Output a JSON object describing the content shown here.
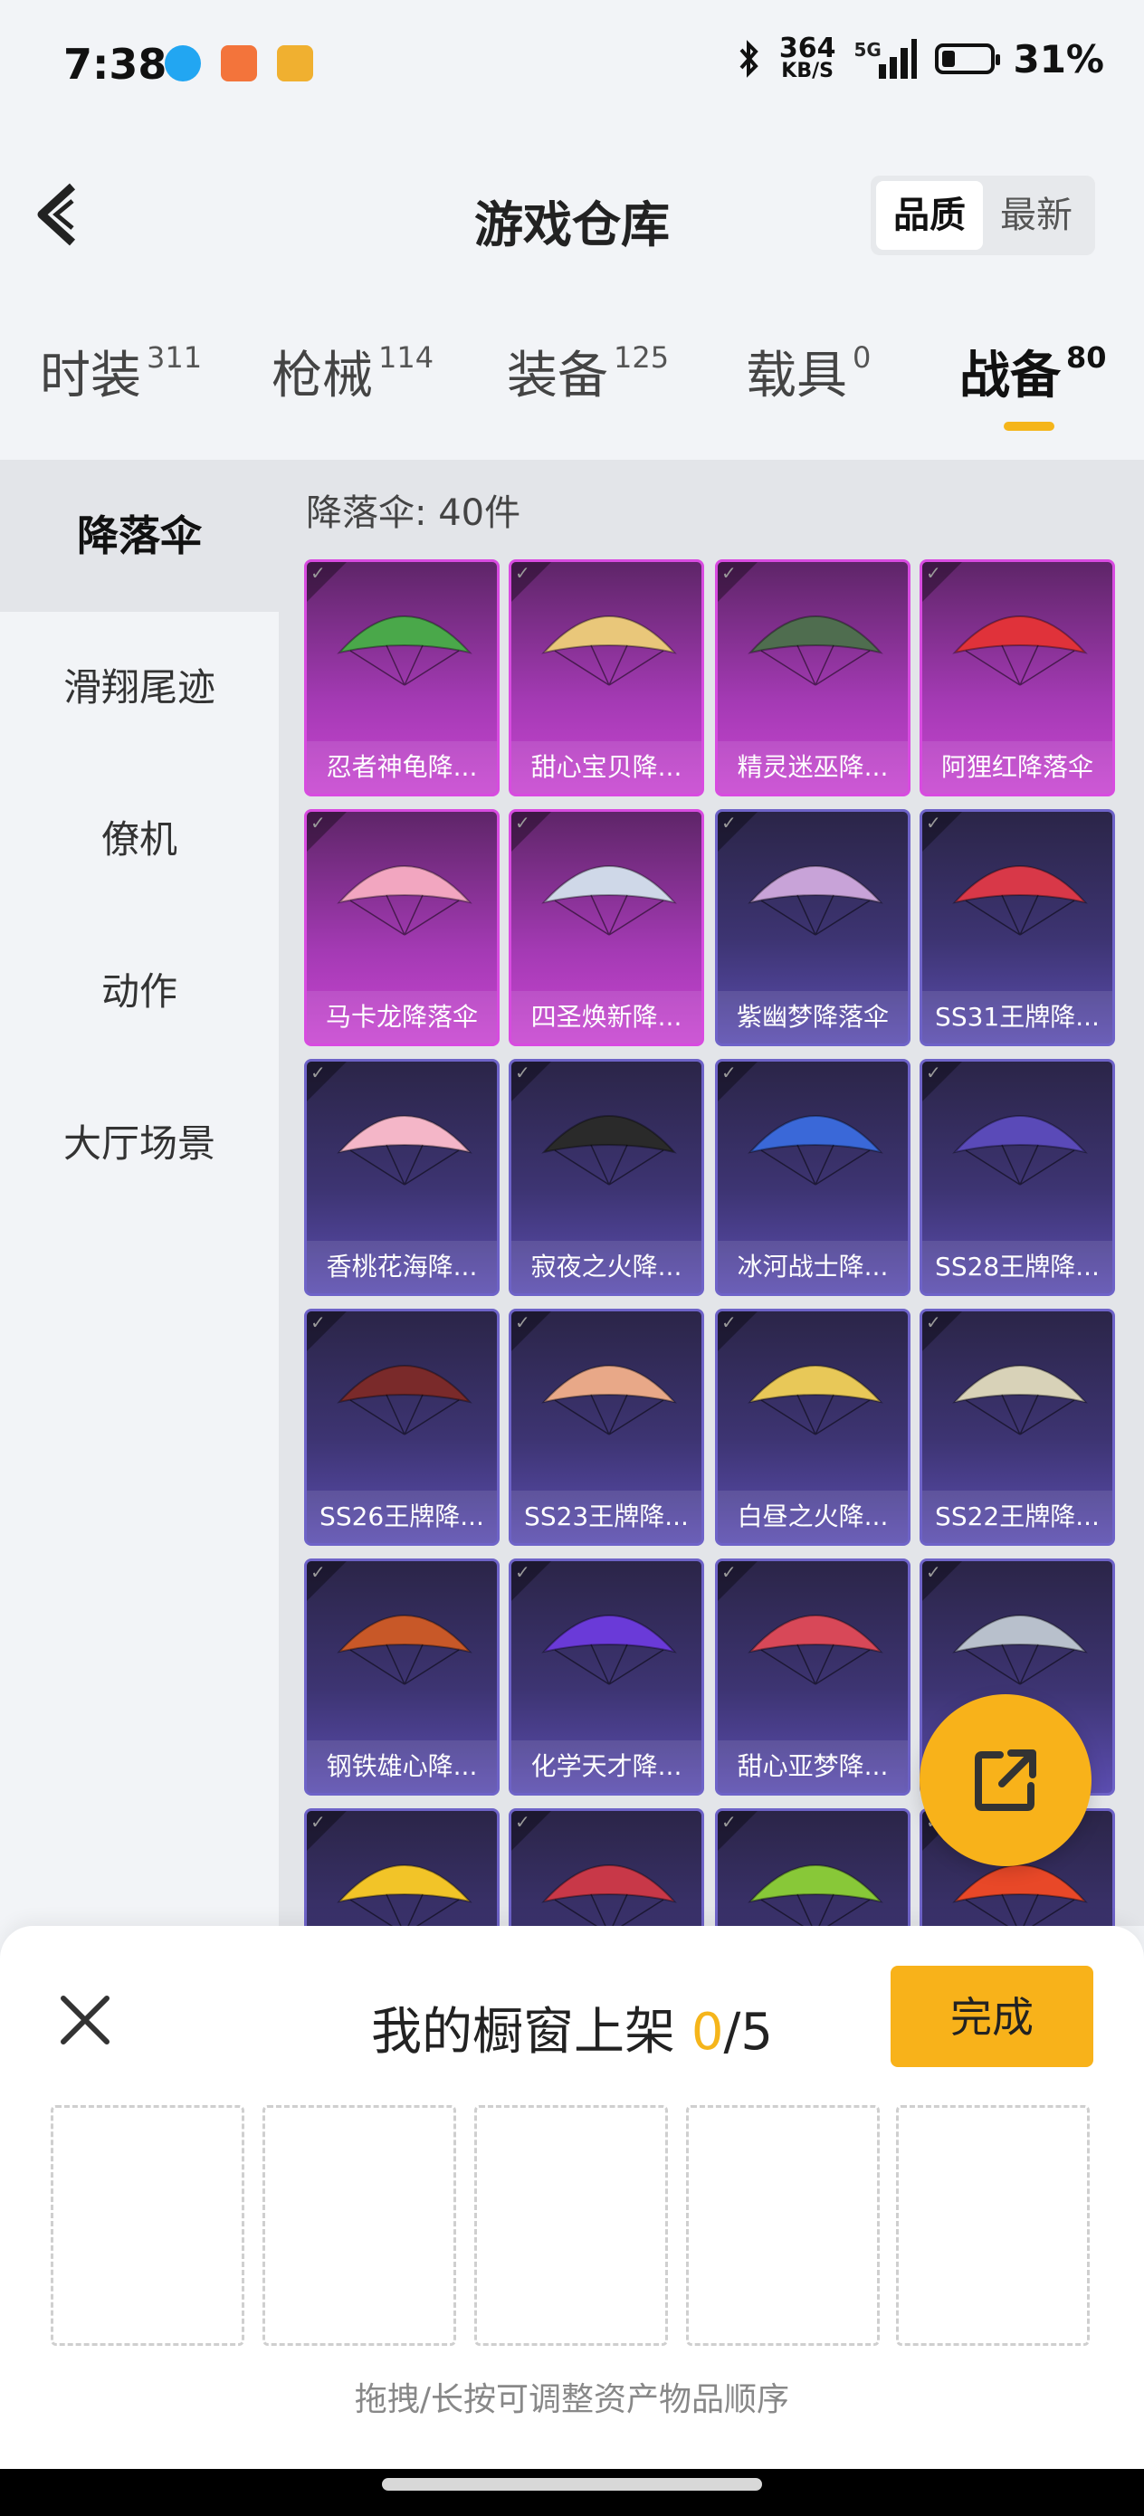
{
  "status": {
    "time": "7:38",
    "speed_value": "364",
    "speed_unit": "KB/S",
    "network": "5G",
    "battery": "31%"
  },
  "header": {
    "title": "游戏仓库",
    "sort_options": [
      "品质",
      "最新"
    ]
  },
  "category_tabs": [
    {
      "label": "时装",
      "count": "311"
    },
    {
      "label": "枪械",
      "count": "114"
    },
    {
      "label": "装备",
      "count": "125"
    },
    {
      "label": "载具",
      "count": "0"
    },
    {
      "label": "战备",
      "count": "80"
    }
  ],
  "sidebar": {
    "items": [
      "降落伞",
      "滑翔尾迹",
      "僚机",
      "动作",
      "大厅场景"
    ]
  },
  "content": {
    "count_label": "降落伞: 40件",
    "items": [
      {
        "name": "忍者神龟降...",
        "tier": "pink",
        "color": "#4aa84a"
      },
      {
        "name": "甜心宝贝降...",
        "tier": "pink",
        "color": "#e9c77a"
      },
      {
        "name": "精灵迷巫降...",
        "tier": "pink",
        "color": "#4f6d4f"
      },
      {
        "name": "阿狸红降落伞",
        "tier": "pink",
        "color": "#e0323a"
      },
      {
        "name": "马卡龙降落伞",
        "tier": "pink",
        "color": "#f2a6c0"
      },
      {
        "name": "四圣焕新降...",
        "tier": "pink",
        "color": "#cfd8e8"
      },
      {
        "name": "紫幽梦降落伞",
        "tier": "purple",
        "color": "#c8a3d8"
      },
      {
        "name": "SS31王牌降...",
        "tier": "purple",
        "color": "#d83848"
      },
      {
        "name": "香桃花海降...",
        "tier": "purple",
        "color": "#f4b6c8"
      },
      {
        "name": "寂夜之火降...",
        "tier": "purple",
        "color": "#2a2a2a"
      },
      {
        "name": "冰河战士降...",
        "tier": "purple",
        "color": "#3a68d8"
      },
      {
        "name": "SS28王牌降...",
        "tier": "purple",
        "color": "#5a4ab8"
      },
      {
        "name": "SS26王牌降...",
        "tier": "purple",
        "color": "#7a2a2a"
      },
      {
        "name": "SS23王牌降...",
        "tier": "purple",
        "color": "#e8a888"
      },
      {
        "name": "白昼之火降...",
        "tier": "purple",
        "color": "#e8c858"
      },
      {
        "name": "SS22王牌降...",
        "tier": "purple",
        "color": "#d8d2b8"
      },
      {
        "name": "钢铁雄心降...",
        "tier": "purple",
        "color": "#c85828"
      },
      {
        "name": "化学天才降...",
        "tier": "purple",
        "color": "#6a3ad8"
      },
      {
        "name": "甜心亚梦降...",
        "tier": "purple",
        "color": "#d84858"
      },
      {
        "name": "",
        "tier": "purple",
        "color": "#b8c0cc"
      },
      {
        "name": "",
        "tier": "purple",
        "color": "#f2c428"
      },
      {
        "name": "",
        "tier": "purple",
        "color": "#c83848"
      },
      {
        "name": "",
        "tier": "purple",
        "color": "#88c838"
      },
      {
        "name": "",
        "tier": "purple",
        "color": "#e84828"
      }
    ]
  },
  "panel": {
    "title_prefix": "我的橱窗上架 ",
    "current": "0",
    "total": "/5",
    "done_label": "完成",
    "hint": "拖拽/长按可调整资产物品顺序"
  },
  "colors": {
    "accent": "#f8b21a",
    "tier_pink": "#c845d1",
    "tier_purple": "#5b4db0"
  }
}
